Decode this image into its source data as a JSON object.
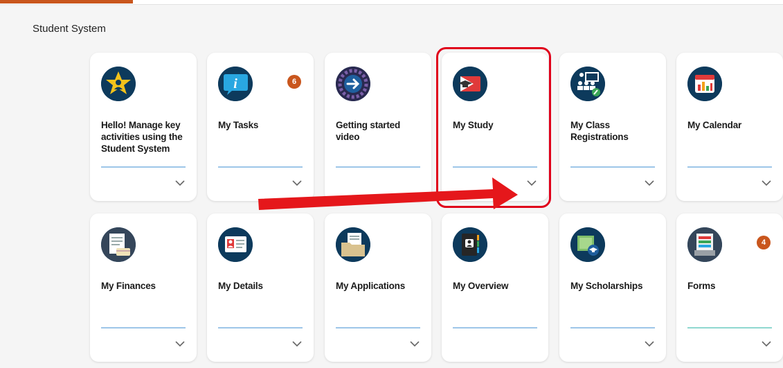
{
  "header": {
    "section_title": "Student System"
  },
  "tiles_row1": [
    {
      "label": "Hello! Manage key activities using the Student System",
      "icon": "star-person-icon"
    },
    {
      "label": "My Tasks",
      "icon": "info-bubble-icon",
      "badge": "6"
    },
    {
      "label": "Getting started video",
      "icon": "arrow-circle-icon"
    },
    {
      "label": "My Study",
      "icon": "graduation-cap-icon"
    },
    {
      "label": "My Class Registrations",
      "icon": "classroom-icon"
    },
    {
      "label": "My Calendar",
      "icon": "calendar-icon"
    }
  ],
  "tiles_row2": [
    {
      "label": "My Finances",
      "icon": "finance-document-icon"
    },
    {
      "label": "My Details",
      "icon": "id-card-icon"
    },
    {
      "label": "My Applications",
      "icon": "folder-icon"
    },
    {
      "label": "My Overview",
      "icon": "notebook-icon"
    },
    {
      "label": "My Scholarships",
      "icon": "scholarship-icon"
    },
    {
      "label": "Forms",
      "icon": "forms-icon",
      "badge": "4"
    }
  ],
  "colors": {
    "accent": "#c9561d",
    "icon_bg": "#0d3a5c",
    "rule": "#9dc6e8",
    "highlight": "#e0001b"
  }
}
